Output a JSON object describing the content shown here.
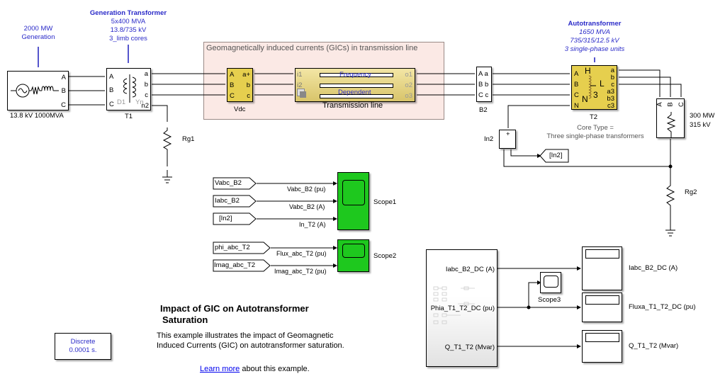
{
  "annotations": {
    "generation": [
      "2000 MW",
      "Generation"
    ],
    "gen_transformer_title": "Generation Transformer",
    "gen_transformer_lines": [
      "5x400 MVA",
      "13.8/735 kV",
      "3_limb cores"
    ],
    "autotransformer_title": "Autotransformer",
    "autotransformer_lines": [
      "1650 MVA",
      "735/315/12.5 kV",
      "3 single-phase units"
    ],
    "gic_area_title": "Geomagnetically induced currents (GICs) in transmission line",
    "core_type": [
      "Core Type =",
      "Three single-phase transformers"
    ],
    "load": [
      "300 MW",
      "315 kV"
    ]
  },
  "blocks": {
    "source": {
      "label": "13.8 kV 1000MVA",
      "ports": [
        "A",
        "B",
        "C"
      ]
    },
    "t1": {
      "label": "T1",
      "in_ports": [
        "A",
        "B",
        "C"
      ],
      "out_ports": [
        "a",
        "b",
        "c",
        "n2"
      ],
      "wind1": "D1",
      "wind2": "Yn"
    },
    "rg1": {
      "label": "Rg1"
    },
    "vdc": {
      "label": "Vdc",
      "in_ports": [
        "A",
        "B",
        "C"
      ],
      "out_ports": [
        "a+",
        "b",
        "c"
      ]
    },
    "line": {
      "label": "Transmission line",
      "in_ports": [
        "i1",
        "i2"
      ],
      "out_ports": [
        "o1",
        "o2",
        "o3"
      ],
      "text1": "Frequency",
      "text2": "Dependent"
    },
    "b2": {
      "label": "B2",
      "ports": [
        "A a",
        "B b",
        "C c"
      ]
    },
    "t2": {
      "label": "T2",
      "in_ports": [
        "A",
        "B",
        "C",
        "N"
      ],
      "out_ports": [
        "a",
        "b",
        "c",
        "a3",
        "b3",
        "c3"
      ],
      "h": "H",
      "l": "L",
      "n": "N",
      "three": "3"
    },
    "load": {
      "ports": [
        "A",
        "B",
        "C"
      ]
    },
    "in2": {
      "label": "In2",
      "plus": "+"
    },
    "goto_in2": {
      "label": "[In2]"
    },
    "rg2": {
      "label": "Rg2"
    },
    "powergui": {
      "lines": [
        "Discrete",
        "0.0001 s."
      ]
    }
  },
  "scope1": {
    "label": "Scope1",
    "inputs": [
      {
        "tag": "Vabc_B2",
        "signal": "Vabc_B2 (pu)"
      },
      {
        "tag": "Iabc_B2",
        "signal": "Vabc_B2 (A)"
      },
      {
        "tag": "[In2]",
        "signal": "In_T2 (A)"
      }
    ]
  },
  "scope2": {
    "label": "Scope2",
    "inputs": [
      {
        "tag": "phi_abc_T2",
        "signal": "Flux_abc_T2 (pu)"
      },
      {
        "tag": "Imag_abc_T2",
        "signal": "Imag_abc_T2 (pu)"
      }
    ]
  },
  "subsystem": {
    "outputs": [
      "Iabc_B2_DC (A)",
      "Phia_T1_T2_DC (pu)",
      "Q_T1_T2 (Mvar)"
    ]
  },
  "scope3": {
    "label": "Scope3"
  },
  "displays": [
    "Iabc_B2_DC (A)",
    "Fluxa_T1_T2_DC (pu)",
    "Q_T1_T2  (Mvar)"
  ],
  "description": {
    "title_line1": "Impact of GIC on Autotransformer",
    "title_line2": "Saturation",
    "body_line1": "This example illustrates the impact of Geomagnetic",
    "body_line2": "Induced Currents (GIC) on autotransformer saturation.",
    "learn_more": "Learn more",
    "learn_more_suffix": " about this example."
  }
}
